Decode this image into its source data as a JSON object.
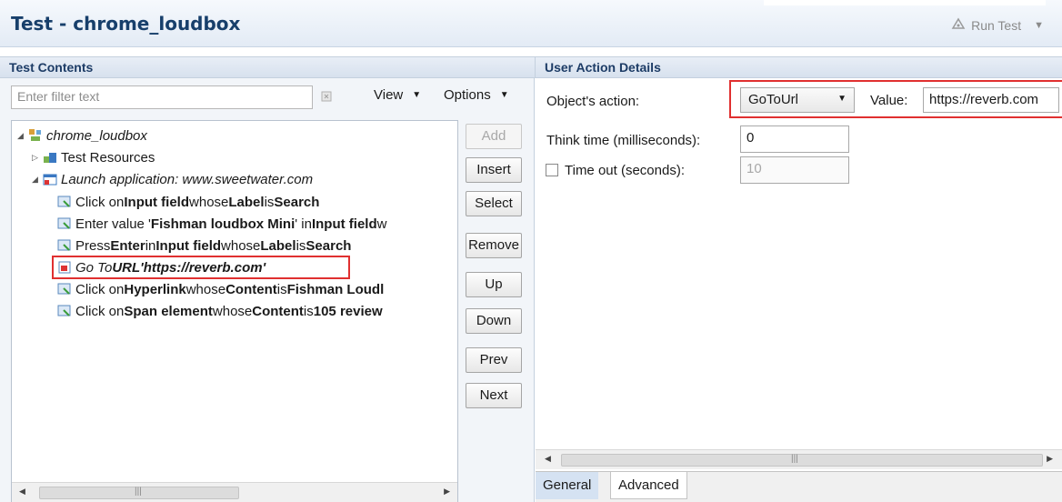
{
  "header": {
    "title": "Test - chrome_loudbox",
    "run_label": "Run Test"
  },
  "left": {
    "section_title": "Test Contents",
    "filter_placeholder": "Enter filter text",
    "view_label": "View",
    "options_label": "Options",
    "tree": {
      "root": "chrome_loudbox",
      "resources": "Test Resources",
      "launch": "Launch application: www.sweetwater.com",
      "steps": [
        {
          "parts": [
            "Click on ",
            "Input field",
            " whose ",
            "Label",
            " is ",
            "Search"
          ]
        },
        {
          "parts": [
            "Enter value '",
            "Fishman loudbox Mini",
            "' in ",
            "Input field",
            " w",
            "",
            ""
          ]
        },
        {
          "parts": [
            "Press ",
            "Enter",
            " in ",
            "Input field",
            " whose ",
            "Label",
            " is ",
            "Search"
          ]
        },
        {
          "parts": [
            "Go To ",
            "URL",
            " ",
            "'https://reverb.com'"
          ]
        },
        {
          "parts": [
            "Click on ",
            "Hyperlink",
            " whose ",
            "Content",
            " is ",
            "Fishman Loudl"
          ]
        },
        {
          "parts": [
            "Click on ",
            "Span element",
            " whose ",
            "Content",
            " is ",
            "105 review"
          ]
        }
      ]
    },
    "buttons": {
      "add": "Add",
      "insert": "Insert",
      "select": "Select",
      "remove": "Remove",
      "up": "Up",
      "down": "Down",
      "prev": "Prev",
      "next": "Next"
    }
  },
  "right": {
    "section_title": "User Action Details",
    "action_label": "Object's action:",
    "action_value": "GoToUrl",
    "value_label": "Value:",
    "value_text": "https://reverb.com",
    "think_label": "Think time (milliseconds):",
    "think_value": "0",
    "timeout_label": "Time out (seconds):",
    "timeout_value": "10",
    "tab_general": "General",
    "tab_advanced": "Advanced"
  },
  "colors": {
    "header_title": "#173f6b",
    "section_title": "#1d3c66",
    "highlight": "#e03030"
  }
}
